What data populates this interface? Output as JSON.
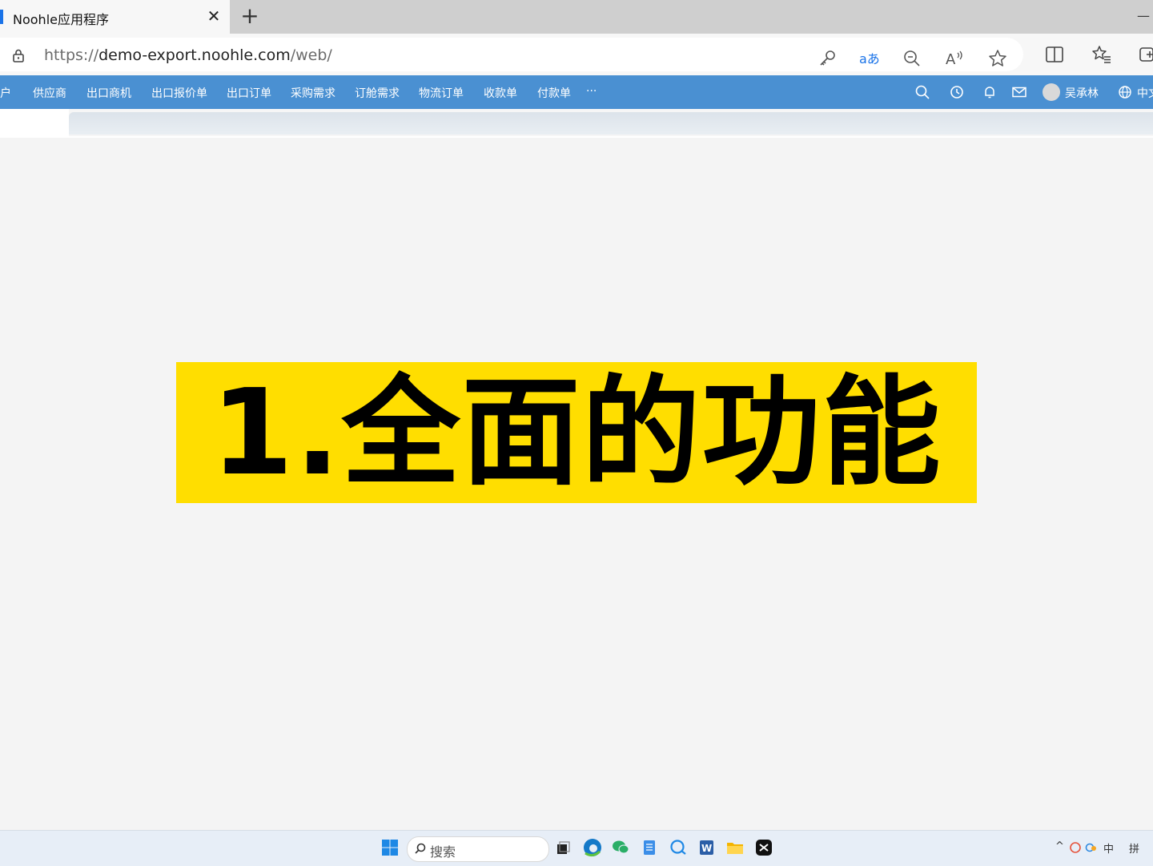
{
  "browser": {
    "tab_title": "Noohle应用程序",
    "tab_close": "✕",
    "new_tab": "+",
    "window_minimize": "—",
    "url_scheme": "https://",
    "url_host": "demo-export.noohle.com",
    "url_path": "/web/",
    "toolbar_icons": [
      "key-icon",
      "translate-icon",
      "zoom-out-icon",
      "read-aloud-icon",
      "favorite-star-icon",
      "split-screen-icon",
      "favorites-icon",
      "collections-icon"
    ]
  },
  "appnav": {
    "items": [
      "户",
      "供应商",
      "出口商机",
      "出口报价单",
      "出口订单",
      "采购需求",
      "订舱需求",
      "物流订单",
      "收款单",
      "付款单",
      "···"
    ],
    "user_name": "吴承林",
    "language": "中文",
    "icons": [
      "search-icon",
      "history-icon",
      "bell-icon",
      "mail-icon",
      "globe-icon"
    ]
  },
  "banner": {
    "text": "1.全面的功能",
    "color": "#ffde00"
  },
  "taskbar": {
    "search_placeholder": "搜索",
    "apps": [
      "windows-start-icon",
      "task-view-icon",
      "edge-icon",
      "wechat-icon",
      "notepad-icon",
      "copilot-icon",
      "word-icon",
      "file-explorer-icon",
      "capcut-icon"
    ],
    "tray_ime": "中",
    "tray_pinyin": "拼",
    "tray_chevron": "^"
  },
  "colors": {
    "nav_bg": "#4a90d2",
    "accent": "#1a73e8",
    "page_bg": "#f4f4f4"
  }
}
